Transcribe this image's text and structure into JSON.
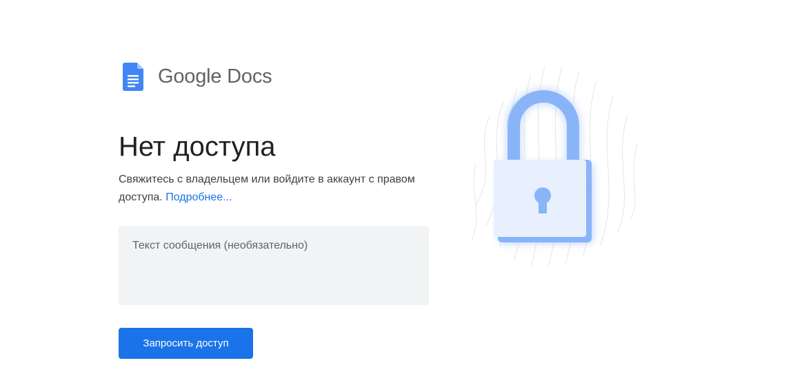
{
  "brand": {
    "product_name": "Google Docs",
    "icon": "docs-icon",
    "colors": {
      "doc_blue": "#4285f4",
      "doc_fold": "#a1c2fa"
    }
  },
  "main": {
    "title": "Нет доступа",
    "description": "Свяжитесь с владельцем или войдите в аккаунт с правом доступа.",
    "learn_more_label": "Подробнее..."
  },
  "message": {
    "placeholder": "Текст сообщения (необязательно)",
    "value": ""
  },
  "actions": {
    "request_access_label": "Запросить доступ"
  },
  "illustration": {
    "icon": "padlock-icon"
  },
  "colors": {
    "accent": "#1a73e8",
    "title_text": "#202124",
    "body_text": "#3c4043",
    "field_background": "#f1f3f4"
  }
}
